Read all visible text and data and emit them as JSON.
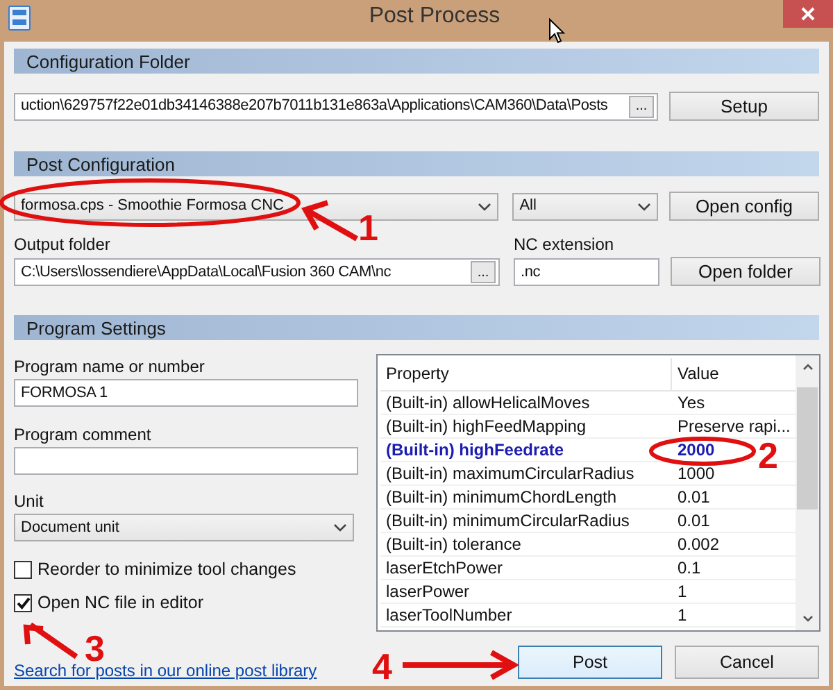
{
  "window": {
    "title": "Post Process"
  },
  "configuration_folder": {
    "heading": "Configuration Folder",
    "path": "uction\\629757f22e01db34146388e207b7011b131e863a\\Applications\\CAM360\\Data\\Posts",
    "browse_button": "...",
    "setup_button": "Setup"
  },
  "post_configuration": {
    "heading": "Post Configuration",
    "post": "formosa.cps - Smoothie Formosa CNC",
    "filter": "All",
    "open_config_button": "Open config",
    "output_folder_label": "Output folder",
    "output_folder": "C:\\Users\\lossendiere\\AppData\\Local\\Fusion 360 CAM\\nc",
    "browse_button": "...",
    "nc_extension_label": "NC extension",
    "nc_extension": ".nc",
    "open_folder_button": "Open folder"
  },
  "program_settings": {
    "heading": "Program Settings",
    "program_name_label": "Program name or number",
    "program_name": "FORMOSA 1",
    "program_comment_label": "Program comment",
    "unit_label": "Unit",
    "unit": "Document unit",
    "checkboxes": [
      {
        "label": "Reorder to minimize tool changes",
        "checked": false
      },
      {
        "label": "Open NC file in editor",
        "checked": true
      }
    ],
    "link": "Search for posts in our online post library"
  },
  "properties": {
    "columns": [
      "Property",
      "Value"
    ],
    "rows": [
      {
        "property": "(Built-in) allowHelicalMoves",
        "value": "Yes",
        "modified": false
      },
      {
        "property": "(Built-in) highFeedMapping",
        "value": "Preserve rapi...",
        "modified": false
      },
      {
        "property": "(Built-in) highFeedrate",
        "value": "2000",
        "modified": true
      },
      {
        "property": "(Built-in) maximumCircularRadius",
        "value": "1000",
        "modified": false
      },
      {
        "property": "(Built-in) minimumChordLength",
        "value": "0.01",
        "modified": false
      },
      {
        "property": "(Built-in) minimumCircularRadius",
        "value": "0.01",
        "modified": false
      },
      {
        "property": "(Built-in) tolerance",
        "value": "0.002",
        "modified": false
      },
      {
        "property": "laserEtchPower",
        "value": "0.1",
        "modified": false
      },
      {
        "property": "laserPower",
        "value": "1",
        "modified": false
      },
      {
        "property": "laserToolNumber",
        "value": "1",
        "modified": false
      }
    ]
  },
  "buttons": [
    {
      "label": "Post",
      "selected": true
    },
    {
      "label": "Cancel",
      "selected": false
    }
  ],
  "annotations": [
    {
      "label": "1"
    },
    {
      "label": "2"
    },
    {
      "label": "3"
    },
    {
      "label": "4"
    }
  ]
}
